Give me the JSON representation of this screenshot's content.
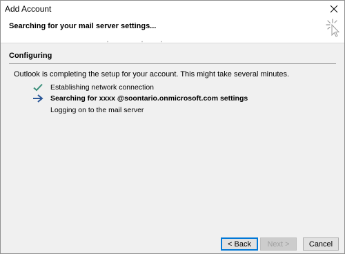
{
  "window": {
    "title": "Add Account"
  },
  "header": {
    "text": "Searching for your mail server settings..."
  },
  "section": {
    "title": "Configuring",
    "description": "Outlook is completing the setup for your account. This might take several minutes."
  },
  "steps": [
    {
      "label": "Establishing network connection",
      "status": "done",
      "icon": "checkmark-icon"
    },
    {
      "label": "Searching for   xxxx @soontario.onmicrosoft.com settings",
      "status": "in-progress",
      "icon": "arrow-right-icon"
    },
    {
      "label": "Logging on to the mail server",
      "status": "pending",
      "icon": ""
    }
  ],
  "buttons": {
    "back": "< Back",
    "next": "Next >",
    "cancel": "Cancel"
  },
  "colors": {
    "check": "#3a8f7a",
    "arrow": "#2b5797",
    "accent": "#0078d7",
    "body_bg": "#f0f0f0"
  }
}
